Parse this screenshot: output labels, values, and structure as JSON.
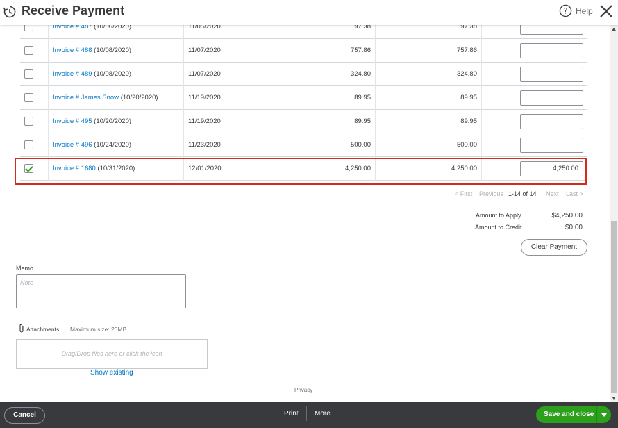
{
  "header": {
    "title": "Receive Payment",
    "help_label": "Help"
  },
  "rows": [
    {
      "invoice_link": "Invoice # 487",
      "invoice_date": "(10/06/2020)",
      "due_date": "11/05/2020",
      "original_amount": "97.38",
      "open_balance": "97.38",
      "payment": "",
      "checked": false
    },
    {
      "invoice_link": "Invoice # 488",
      "invoice_date": "(10/08/2020)",
      "due_date": "11/07/2020",
      "original_amount": "757.86",
      "open_balance": "757.86",
      "payment": "",
      "checked": false
    },
    {
      "invoice_link": "Invoice # 489",
      "invoice_date": "(10/08/2020)",
      "due_date": "11/07/2020",
      "original_amount": "324.80",
      "open_balance": "324.80",
      "payment": "",
      "checked": false
    },
    {
      "invoice_link": "Invoice # James Snow",
      "invoice_date": "(10/20/2020)",
      "due_date": "11/19/2020",
      "original_amount": "89.95",
      "open_balance": "89.95",
      "payment": "",
      "checked": false
    },
    {
      "invoice_link": "Invoice # 495",
      "invoice_date": "(10/20/2020)",
      "due_date": "11/19/2020",
      "original_amount": "89.95",
      "open_balance": "89.95",
      "payment": "",
      "checked": false
    },
    {
      "invoice_link": "Invoice # 496",
      "invoice_date": "(10/24/2020)",
      "due_date": "11/23/2020",
      "original_amount": "500.00",
      "open_balance": "500.00",
      "payment": "",
      "checked": false
    },
    {
      "invoice_link": "Invoice # 1680",
      "invoice_date": "(10/31/2020)",
      "due_date": "12/01/2020",
      "original_amount": "4,250.00",
      "open_balance": "4,250.00",
      "payment": "4,250.00",
      "checked": true
    }
  ],
  "pagination": {
    "first": "< First",
    "previous": "Previous",
    "range": "1-14 of 14",
    "next": "Next",
    "last": "Last >"
  },
  "totals": {
    "amount_to_apply_label": "Amount to Apply",
    "amount_to_apply_value": "$4,250.00",
    "amount_to_credit_label": "Amount to Credit",
    "amount_to_credit_value": "$0.00",
    "clear_payment_label": "Clear Payment"
  },
  "memo": {
    "label": "Memo",
    "placeholder": "Note"
  },
  "attachments": {
    "label": "Attachments",
    "max_size": "Maximum size: 20MB",
    "drop_hint": "Drag/Drop files here or click the icon",
    "show_existing": "Show existing"
  },
  "privacy": "Privacy",
  "footer": {
    "cancel_label": "Cancel",
    "print_label": "Print",
    "more_label": "More",
    "save_label": "Save and close"
  },
  "colors": {
    "accent_green": "#2ca01c",
    "link_blue": "#0077c5",
    "highlight_red": "#d52b1e",
    "footer_dark": "#393a3d"
  }
}
